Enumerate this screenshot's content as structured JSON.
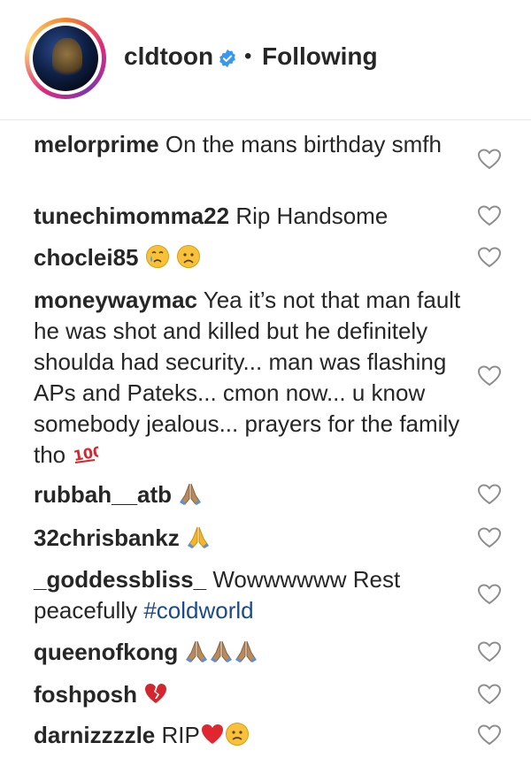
{
  "header": {
    "username": "cldtoon",
    "separator": "•",
    "follow_status": "Following"
  },
  "comments": [
    {
      "user": "melorprime",
      "text": "On the mans birthday smfh"
    },
    {
      "user": "tunechimomma22",
      "text": "Rip Handsome"
    },
    {
      "user": "choclei85",
      "text": "",
      "emojis": [
        "crying-face-icon",
        "sad-face-icon"
      ]
    },
    {
      "user": "moneywaymac",
      "text": "Yea it’s not that man fault he was shot and killed but he definitely shoulda had security... man was flashing APs and Pateks... cmon now... u know somebody jealous... prayers for the family tho",
      "emojis": [
        "hundred-points-icon"
      ]
    },
    {
      "user": "rubbah__atb",
      "text": "",
      "emojis": [
        "praying-hands-icon"
      ]
    },
    {
      "user": "32chrisbankz",
      "text": "",
      "emojis": [
        "praying-hands-icon"
      ]
    },
    {
      "user": "_goddessbliss_",
      "text": "Wowwwwww Rest peacefully",
      "hashtag": "#coldworld"
    },
    {
      "user": "queenofkong",
      "text": "",
      "emojis": [
        "praying-hands-icon",
        "praying-hands-icon",
        "praying-hands-icon"
      ]
    },
    {
      "user": "foshposh",
      "text": "",
      "emojis": [
        "broken-heart-icon"
      ]
    },
    {
      "user": "darnizzzzle",
      "text": "RIP",
      "emojis": [
        "red-heart-icon",
        "frowning-face-icon"
      ]
    }
  ],
  "colors": {
    "text": "#262626",
    "verified": "#3897f0",
    "hashtag": "#1b4a8a",
    "heart_outline": "#8e8e8e"
  }
}
